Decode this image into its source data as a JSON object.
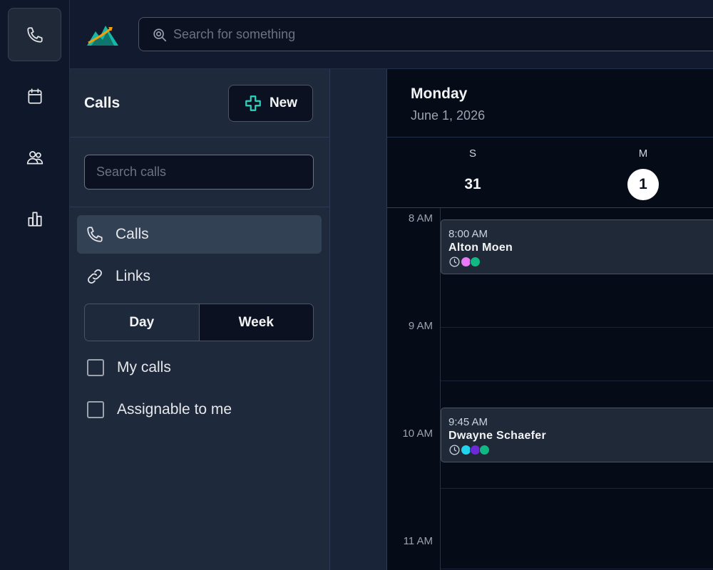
{
  "topbar": {
    "search_placeholder": "Search for something"
  },
  "rail": {
    "items": [
      "phone-icon",
      "calendar-icon",
      "users-icon",
      "analytics-icon"
    ]
  },
  "panel": {
    "title": "Calls",
    "new_label": "New",
    "search_placeholder": "Search calls",
    "nav": [
      {
        "label": "Calls",
        "icon": "phone-icon"
      },
      {
        "label": "Links",
        "icon": "link-icon"
      }
    ],
    "view_toggle": {
      "day": "Day",
      "week": "Week",
      "selected": "Week"
    },
    "filters": [
      {
        "label": "My calls",
        "checked": false
      },
      {
        "label": "Assignable to me",
        "checked": false
      }
    ]
  },
  "calendar": {
    "day_name": "Monday",
    "date": "June 1, 2026",
    "week": [
      {
        "weekday": "S",
        "day": "31"
      },
      {
        "weekday": "M",
        "day": "1",
        "today": true
      }
    ],
    "hours": [
      "8 AM",
      "9 AM",
      "10 AM",
      "11 AM"
    ],
    "events": [
      {
        "time": "8:00 AM",
        "name": "Alton Moen",
        "attendee_colors": [
          "#e879f9",
          "#10b981"
        ]
      },
      {
        "time": "9:45 AM",
        "name": "Dwayne Schaefer",
        "attendee_colors": [
          "#22d3ee",
          "#6d28d9",
          "#10b981"
        ]
      }
    ]
  },
  "colors": {
    "accent_green": "#2dd4bf",
    "today_circle": "#ffffff"
  }
}
